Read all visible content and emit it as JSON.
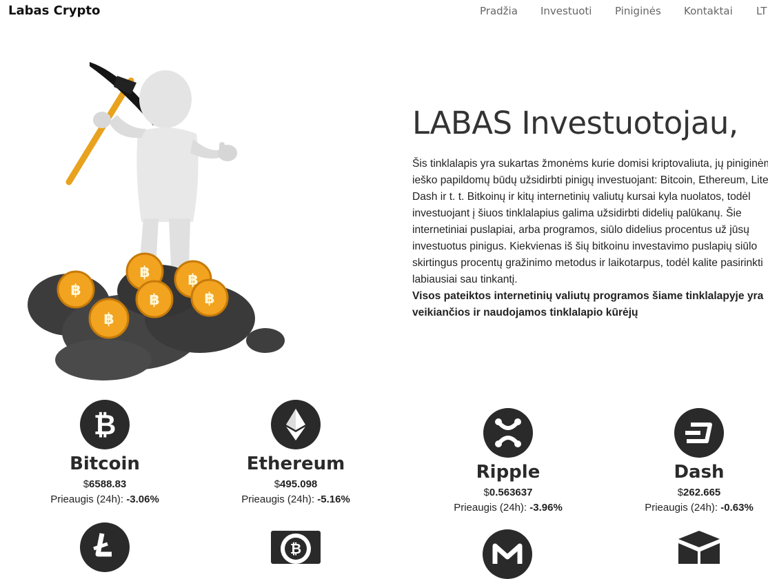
{
  "nav": {
    "brand": "Labas Crypto",
    "links": [
      "Pradžia",
      "Investuoti",
      "Piniginės",
      "Kontaktai",
      "LT"
    ]
  },
  "hero": {
    "title": "LABAS Investuotojau,",
    "paragraph": "Šis tinklalapis yra sukartas žmonėms kurie domisi kriptovaliuta, jų piniginėmis ir ieško papildomų būdų užsidirbti pinigų investuojant: Bitcoin, Ethereum, LiteCoin, Dash ir t. t. Bitkoinų ir kitų internetinių valiutų kursai kyla nuolatos, todėl investuojant į šiuos tinklalapius galima užsidirbti didelių palūkanų. Šie internetiniai puslapiai, arba programos, siūlo didelius procentus už jūsų investuotus pinigus. Kiekvienas iš šių bitkoinu investavimo puslapių siūlo skirtingus procentų gražinimo metodus ir laikotarpus, todėl kalite pasirinkti labiausiai sau tinkantį.",
    "bold_text": "Visos pateiktos internetinių valiutų programos šiame tinklalapyje yra veikiančios ir naudojamos tinklalapio kūrėjų"
  },
  "coins": [
    {
      "name": "Bitcoin",
      "currency": "$",
      "price": "6588.83",
      "change_label": "Prieaugis (24h): ",
      "change": "-3.06%",
      "icon": "bitcoin-icon"
    },
    {
      "name": "Ethereum",
      "currency": "$",
      "price": "495.098",
      "change_label": "Prieaugis (24h): ",
      "change": "-5.16%",
      "icon": "ethereum-icon"
    },
    {
      "name": "Ripple",
      "currency": "$",
      "price": "0.563637",
      "change_label": "Prieaugis (24h): ",
      "change": "-3.96%",
      "icon": "ripple-icon"
    },
    {
      "name": "Dash",
      "currency": "$",
      "price": "262.665",
      "change_label": "Prieaugis (24h): ",
      "change": "-0.63%",
      "icon": "dash-icon"
    }
  ],
  "coins_row2_icons": [
    "litecoin-icon",
    "bitcoin-cash-icon",
    "monero-icon",
    "cube-icon"
  ],
  "colors": {
    "coin_dark": "#2a2a2a",
    "gold": "#f0a020"
  }
}
